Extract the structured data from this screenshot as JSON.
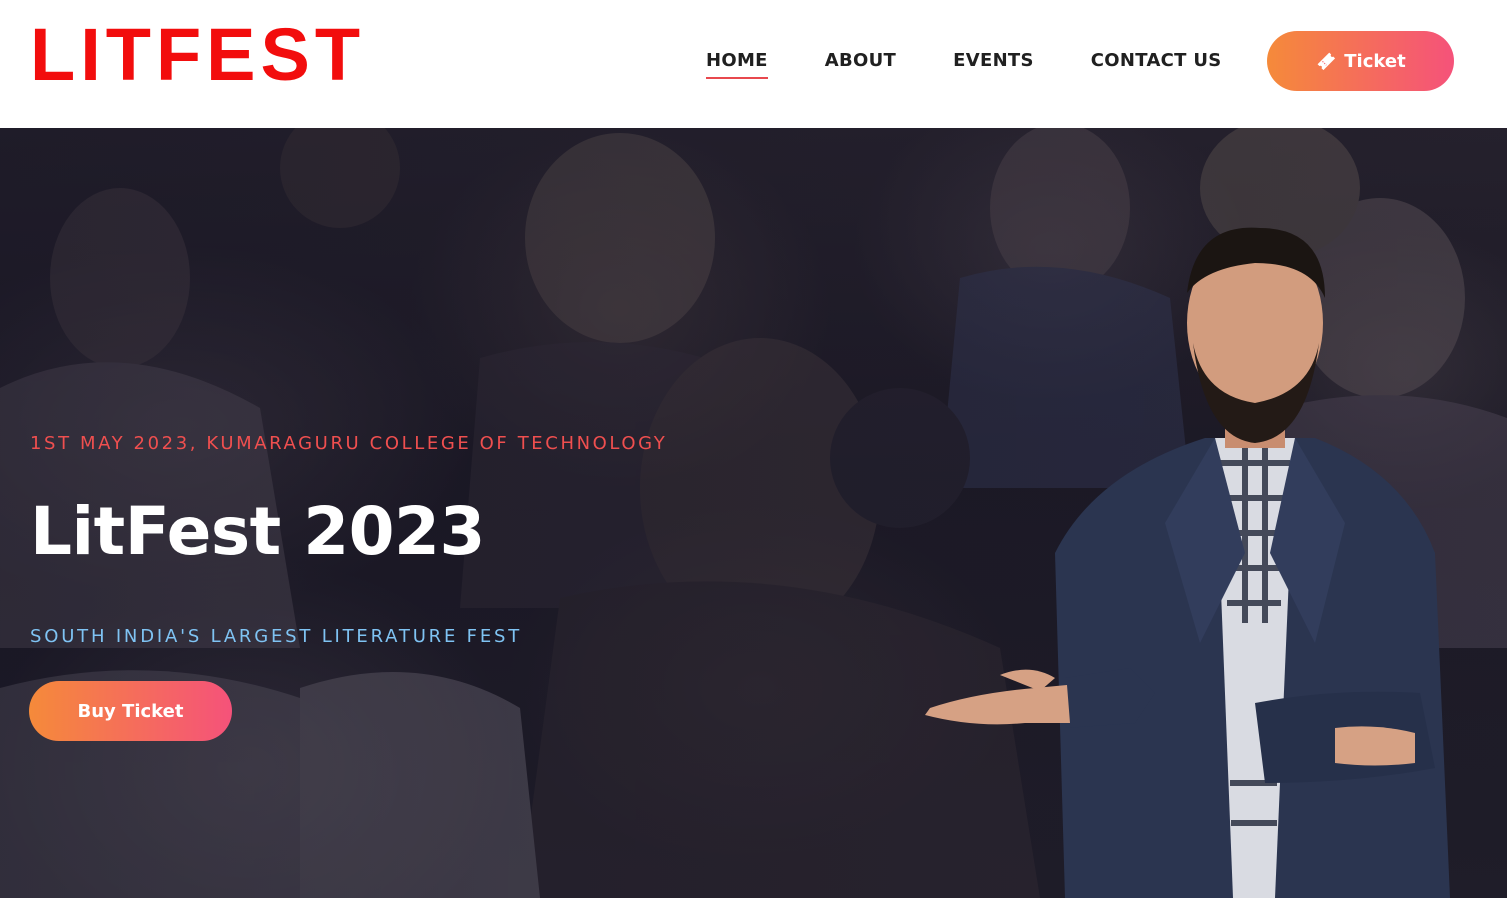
{
  "header": {
    "logo": "LITFEST",
    "nav": [
      {
        "label": "HOME",
        "active": true
      },
      {
        "label": "ABOUT",
        "active": false
      },
      {
        "label": "EVENTS",
        "active": false
      },
      {
        "label": "CONTACT US",
        "active": false
      }
    ],
    "ticket_button": {
      "label": "Ticket",
      "icon": "ticket-icon"
    }
  },
  "hero": {
    "date_venue": "1ST MAY 2023, KUMARAGURU COLLEGE OF TECHNOLOGY",
    "title": "LitFest 2023",
    "subtitle": "SOUTH INDIA'S LARGEST LITERATURE FEST",
    "buy_button": "Buy Ticket"
  },
  "colors": {
    "logo": "#f20d0d",
    "accent_gradient_start": "#f58a3a",
    "accent_gradient_end": "#f5527a",
    "date_text": "#ef4f4f",
    "subtitle_text": "#7fc3f3",
    "hero_bg": "#1e1b26",
    "nav_underline": "#e8484e"
  }
}
